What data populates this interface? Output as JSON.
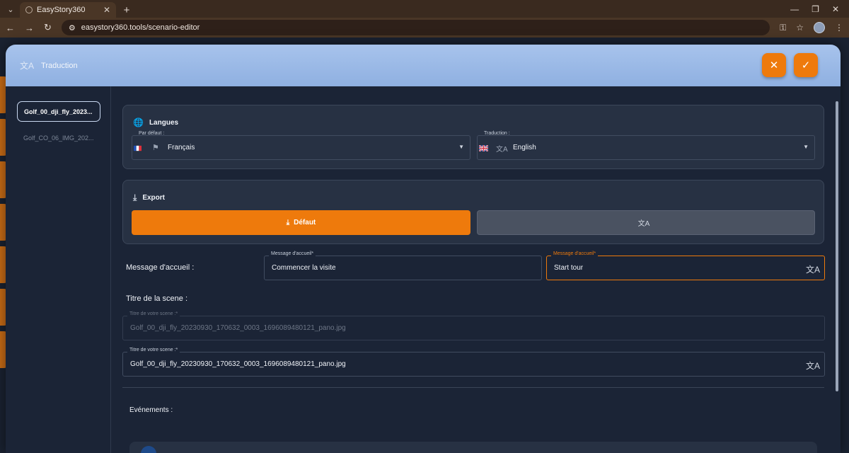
{
  "browser": {
    "tab_title": "EasyStory360",
    "url": "easystory360.tools/scenario-editor"
  },
  "modal": {
    "title": "Traduction",
    "close_icon": "close-icon",
    "confirm_icon": "check-icon"
  },
  "sidebar": {
    "items": [
      {
        "label": "Golf_00_dji_fly_2023...",
        "active": true
      },
      {
        "label": "Golf_CO_06_IMG_202...",
        "active": false
      }
    ]
  },
  "langues": {
    "title": "Langues",
    "default_label": "Par défaut :",
    "default_value": "Français",
    "translation_label": "Traduction :",
    "translation_value": "English"
  },
  "export": {
    "title": "Export",
    "default_button": "Défaut",
    "translation_button": ""
  },
  "welcome": {
    "section_label": "Message d'accueil :",
    "source_label": "Message d'accueil*",
    "source_value": "Commencer la visite",
    "target_label": "Message d'accueil*",
    "target_value": "Start tour"
  },
  "scene_title": {
    "section_label": "Titre de la scene :",
    "source_label": "Titre de votre scene :*",
    "source_value": "Golf_00_dji_fly_20230930_170632_0003_1696089480121_pano.jpg",
    "target_label": "Titre de votre scene :*",
    "target_value": "Golf_00_dji_fly_20230930_170632_0003_1696089480121_pano.jpg"
  },
  "events": {
    "section_label": "Evénements :"
  },
  "colors": {
    "accent": "#ee7a0c",
    "header": "#9dbbe8",
    "background": "#1b2436"
  }
}
